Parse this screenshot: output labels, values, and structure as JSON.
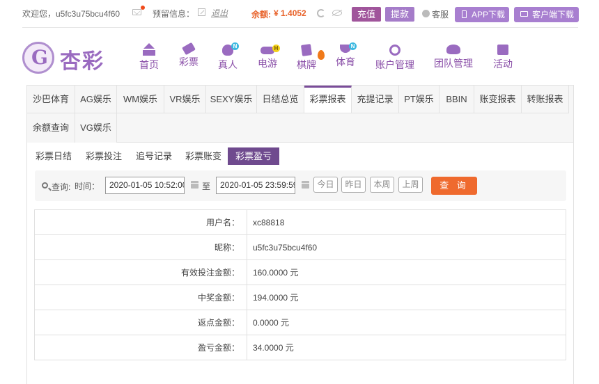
{
  "topbar": {
    "welcome": "欢迎您，u5fc3u75bcu4f60",
    "preinfo_label": "预留信息：",
    "logout": "退出",
    "balance_label": "余额:",
    "balance_value": "¥ 1.4052",
    "deposit": "充值",
    "withdraw": "提款",
    "customer_service": "客服",
    "app_download": "APP下载",
    "client_download": "客户端下载"
  },
  "logo": {
    "text": "杏彩"
  },
  "nav": {
    "items": [
      {
        "label": "首页",
        "icon": "home-icon"
      },
      {
        "label": "彩票",
        "icon": "lottery-ticket-icon"
      },
      {
        "label": "真人",
        "icon": "live-dealer-icon",
        "badge": "N"
      },
      {
        "label": "电游",
        "icon": "gamepad-icon",
        "badge": "H"
      },
      {
        "label": "棋牌",
        "icon": "cards-icon",
        "badge_icon": "flame-icon"
      },
      {
        "label": "体育",
        "icon": "trophy-icon",
        "badge": "N"
      },
      {
        "label": "账户管理",
        "icon": "account-icon"
      },
      {
        "label": "团队管理",
        "icon": "team-icon"
      },
      {
        "label": "活动",
        "icon": "gift-icon"
      }
    ]
  },
  "tabs": {
    "items": [
      "沙巴体育",
      "AG娱乐",
      "WM娱乐",
      "VR娱乐",
      "SEXY娱乐",
      "日结总览",
      "彩票报表",
      "充提记录",
      "PT娱乐",
      "BBIN",
      "账变报表",
      "转账报表",
      "余额查询",
      "VG娱乐"
    ],
    "active": "彩票报表"
  },
  "subtabs": {
    "items": [
      "彩票日结",
      "彩票投注",
      "追号记录",
      "彩票账变",
      "彩票盈亏"
    ],
    "active": "彩票盈亏"
  },
  "search": {
    "label": "查询:",
    "time_label": "时间：",
    "start": "2020-01-05 10:52:00",
    "to_label": "至",
    "end": "2020-01-05 23:59:59",
    "quick": [
      "今日",
      "昨日",
      "本周",
      "上周"
    ],
    "query_button": "查 询"
  },
  "report": {
    "rows": [
      {
        "key": "用户名：",
        "value": "xc88818"
      },
      {
        "key": "昵称：",
        "value": "u5fc3u75bcu4f60"
      },
      {
        "key": "有效投注金额：",
        "value": "160.0000 元"
      },
      {
        "key": "中奖金额：",
        "value": "194.0000 元"
      },
      {
        "key": "返点金额：",
        "value": "0.0000 元"
      },
      {
        "key": "盈亏金额：",
        "value": "34.0000 元"
      }
    ]
  },
  "colors": {
    "accent": "#7a4d99",
    "orange": "#ef6a2e",
    "brand": "#9a6bc0"
  }
}
